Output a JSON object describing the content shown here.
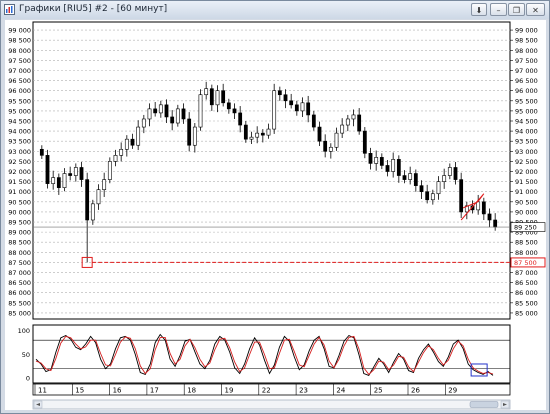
{
  "window": {
    "title": "Графики [RIU5] #2 - [60 минут]",
    "buttons": [
      {
        "name": "download-button",
        "glyph": "⬇"
      },
      {
        "name": "minimize-button",
        "glyph": "–"
      },
      {
        "name": "restore-button",
        "glyph": "❐"
      },
      {
        "name": "close-button",
        "glyph": "✕"
      }
    ]
  },
  "chart_data": [
    {
      "type": "candlestick",
      "x_day_labels": [
        "11",
        "15",
        "16",
        "17",
        "18",
        "19",
        "22",
        "23",
        "24",
        "25",
        "26",
        "29"
      ],
      "y_ticks": [
        85000,
        85500,
        86000,
        86500,
        87000,
        87500,
        88000,
        88500,
        89000,
        89500,
        90000,
        90500,
        91000,
        91500,
        92000,
        92500,
        93000,
        93500,
        94000,
        94500,
        95000,
        95500,
        96000,
        96500,
        97000,
        97500,
        98000,
        98500,
        99000
      ],
      "ylim": [
        84700,
        99400
      ],
      "grid": true,
      "right_axis_last_price_label": "89 250",
      "right_axis_level_label": "87 500",
      "support_level": 87500,
      "annotations": [
        "red square at the 87 500 spike low",
        "red dashed horizontal line at 87 500",
        "red triangle pattern near the end",
        "blue rectangle on the oscillator near the end"
      ],
      "colors": {
        "up": "#ffffff",
        "down": "#000000",
        "annotation": "#e01b1b",
        "grid": "#b0b0b0"
      },
      "closes": [
        92800,
        91400,
        91700,
        91200,
        91900,
        91800,
        92200,
        91600,
        89600,
        90400,
        91100,
        91600,
        92500,
        92800,
        93100,
        93600,
        93300,
        94200,
        94600,
        95100,
        94900,
        95300,
        94700,
        94400,
        95100,
        94600,
        93300,
        94200,
        95800,
        96100,
        95300,
        96000,
        95400,
        95100,
        94900,
        94300,
        93600,
        93700,
        93900,
        93800,
        94100,
        96000,
        95800,
        95500,
        95300,
        95000,
        95400,
        94800,
        94200,
        93500,
        93000,
        93200,
        93900,
        94300,
        94600,
        94800,
        94000,
        92900,
        92400,
        92700,
        92300,
        92000,
        92600,
        91800,
        91600,
        91900,
        91300,
        91000,
        90600,
        90900,
        91500,
        91800,
        92200,
        91600,
        90000,
        90300,
        90100,
        90500,
        89900,
        89600,
        89250
      ],
      "day_start_bars": [
        0,
        9,
        18,
        27,
        36,
        45,
        54,
        63,
        71,
        80,
        89,
        98
      ]
    },
    {
      "type": "line",
      "name": "stochastic",
      "y_ticks": [
        0,
        50,
        100
      ],
      "ylim": [
        -10,
        112
      ],
      "levels": [
        20,
        80
      ],
      "series": [
        {
          "values": [
            40,
            30,
            14,
            18,
            55,
            85,
            90,
            82,
            65,
            60,
            72,
            88,
            75,
            40,
            20,
            30,
            62,
            85,
            88,
            80,
            50,
            12,
            8,
            30,
            75,
            92,
            80,
            40,
            25,
            48,
            78,
            82,
            55,
            30,
            20,
            38,
            72,
            88,
            80,
            55,
            22,
            10,
            30,
            62,
            85,
            70,
            38,
            10,
            28,
            65,
            88,
            78,
            45,
            18,
            28,
            58,
            80,
            88,
            62,
            25,
            22,
            48,
            78,
            90,
            85,
            50,
            10,
            6,
            24,
            42,
            30,
            12,
            34,
            52,
            40,
            16,
            12,
            42,
            60,
            72,
            55,
            35,
            25,
            45,
            72,
            80,
            62,
            30,
            18,
            12,
            8,
            14,
            6
          ]
        },
        {
          "values": [
            36,
            32,
            20,
            16,
            42,
            74,
            88,
            85,
            72,
            62,
            66,
            80,
            80,
            52,
            28,
            26,
            50,
            76,
            87,
            84,
            62,
            26,
            10,
            20,
            60,
            86,
            86,
            52,
            30,
            40,
            68,
            82,
            64,
            40,
            24,
            32,
            60,
            82,
            84,
            64,
            34,
            14,
            22,
            50,
            76,
            76,
            50,
            20,
            22,
            52,
            80,
            82,
            56,
            28,
            24,
            48,
            72,
            86,
            70,
            36,
            22,
            40,
            68,
            86,
            88,
            62,
            22,
            8,
            18,
            36,
            34,
            18,
            28,
            46,
            44,
            24,
            14,
            34,
            54,
            68,
            60,
            42,
            28,
            38,
            62,
            78,
            68,
            40,
            22,
            15,
            10,
            12,
            9
          ]
        }
      ]
    }
  ]
}
